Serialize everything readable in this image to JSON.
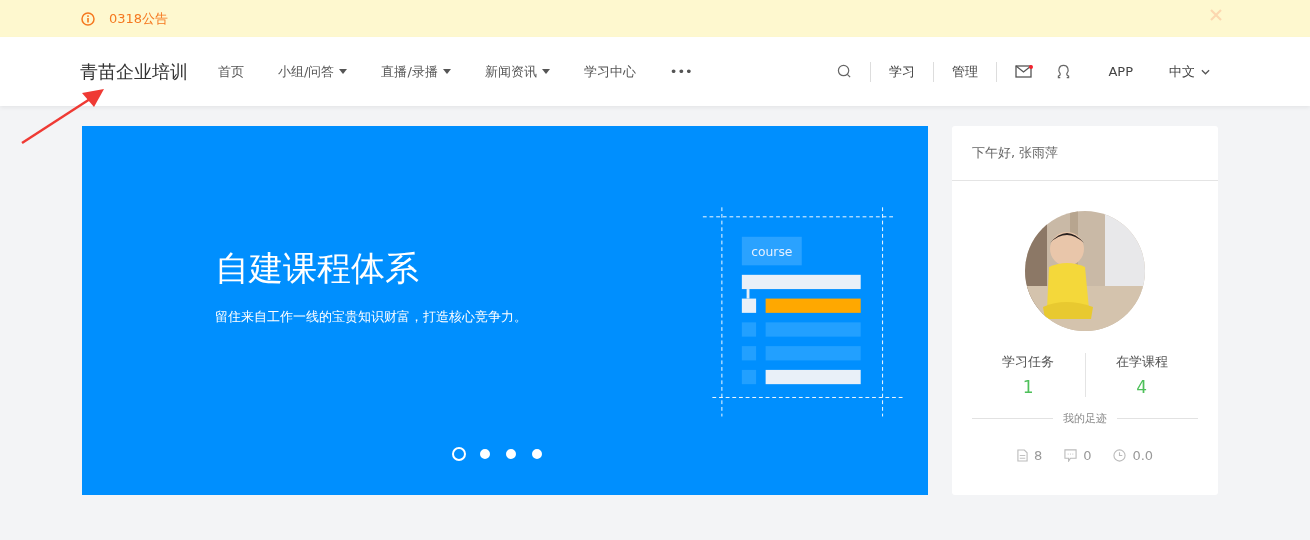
{
  "notice": {
    "text": "0318公告",
    "closable": true
  },
  "header": {
    "logo": "青苗企业培训",
    "nav": [
      {
        "label": "首页",
        "dropdown": false
      },
      {
        "label": "小组/问答",
        "dropdown": true
      },
      {
        "label": "直播/录播",
        "dropdown": true
      },
      {
        "label": "新闻资讯",
        "dropdown": true
      },
      {
        "label": "学习中心",
        "dropdown": false
      },
      {
        "label": "•••",
        "dropdown": false
      }
    ],
    "links": [
      "学习",
      "管理"
    ],
    "mail_unread": true,
    "app": "APP",
    "language": "中文"
  },
  "banner": {
    "title": "自建课程体系",
    "subtitle": "留住来自工作一线的宝贵知识财富，打造核心竞争力。",
    "badge": "course",
    "dots": [
      {
        "selected": true
      },
      {
        "selected": false
      },
      {
        "selected": false
      },
      {
        "selected": false
      }
    ]
  },
  "user_card": {
    "greeting": "下午好, 张雨萍",
    "stats": [
      {
        "label": "学习任务",
        "value": "1"
      },
      {
        "label": "在学课程",
        "value": "4"
      }
    ],
    "footprint_title": "我的足迹",
    "footprint": [
      {
        "kind": "docs",
        "value": "8"
      },
      {
        "kind": "comments",
        "value": "0"
      },
      {
        "kind": "hours",
        "value": "0.0"
      }
    ]
  }
}
